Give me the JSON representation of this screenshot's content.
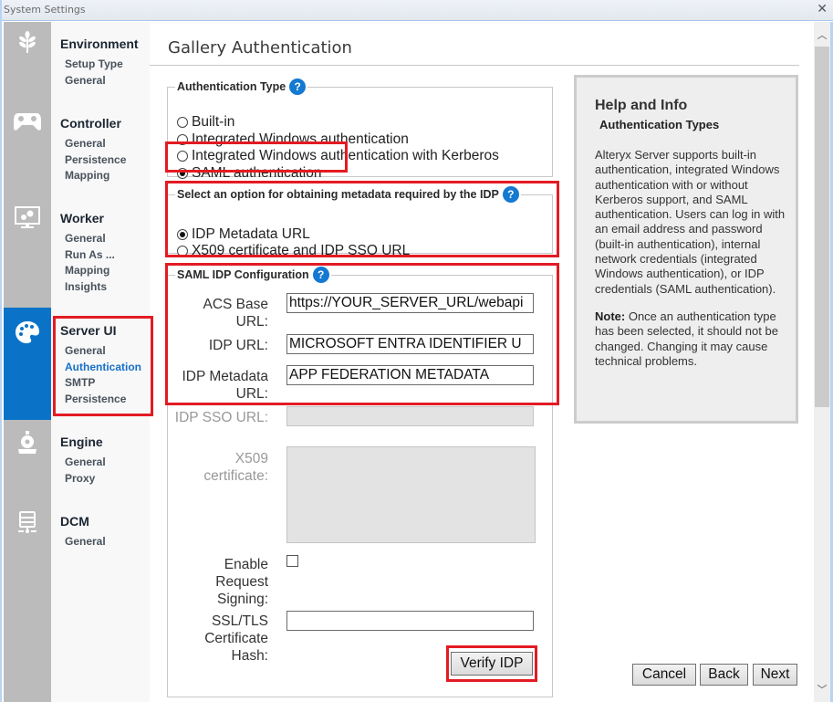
{
  "window": {
    "title": "System Settings",
    "close_icon": "close-x-icon"
  },
  "icon_rail": [
    {
      "icon": "wheat-icon",
      "section": "Environment"
    },
    {
      "icon": "gamepad-icon",
      "section": "Controller"
    },
    {
      "icon": "monitor-gears-icon",
      "section": "Worker"
    },
    {
      "icon": "palette-icon",
      "section": "Server UI",
      "active": true
    },
    {
      "icon": "train-icon",
      "section": "Engine"
    },
    {
      "icon": "database-icon",
      "section": "DCM"
    }
  ],
  "nav": {
    "groups": [
      {
        "title": "Environment",
        "items": [
          "Setup Type",
          "General"
        ]
      },
      {
        "title": "Controller",
        "items": [
          "General",
          "Persistence",
          "Mapping"
        ]
      },
      {
        "title": "Worker",
        "items": [
          "General",
          "Run As ...",
          "Mapping",
          "Insights"
        ]
      },
      {
        "title": "Server UI",
        "items": [
          "General",
          "Authentication",
          "SMTP",
          "Persistence"
        ],
        "active_item": "Authentication"
      },
      {
        "title": "Engine",
        "items": [
          "General",
          "Proxy"
        ]
      },
      {
        "title": "DCM",
        "items": [
          "General"
        ]
      }
    ]
  },
  "page": {
    "title": "Gallery Authentication",
    "auth_type": {
      "legend": "Authentication Type",
      "help_icon": "?",
      "options": [
        {
          "label": "Built-in",
          "selected": false
        },
        {
          "label": "Integrated Windows authentication",
          "selected": false
        },
        {
          "label": "Integrated Windows authentication with Kerberos",
          "selected": false
        },
        {
          "label": "SAML authentication",
          "selected": true
        }
      ]
    },
    "metadata_option": {
      "legend": "Select an option for obtaining metadata required by the IDP",
      "help_icon": "?",
      "options": [
        {
          "label": "IDP Metadata URL",
          "selected": true
        },
        {
          "label": "X509 certificate and IDP SSO URL",
          "selected": false
        }
      ]
    },
    "saml_config": {
      "legend": "SAML IDP Configuration",
      "help_icon": "?",
      "fields": {
        "acs_base_url": {
          "label": "ACS Base URL:",
          "value": "https://YOUR_SERVER_URL/webapi"
        },
        "idp_url": {
          "label": "IDP URL:",
          "value": "MICROSOFT ENTRA IDENTIFIER U"
        },
        "idp_metadata_url": {
          "label": "IDP Metadata URL:",
          "value": "APP FEDERATION METADATA"
        },
        "idp_sso_url": {
          "label": "IDP SSO URL:",
          "value": "",
          "disabled": true
        },
        "x509_certificate": {
          "label": "X509 certificate:",
          "value": "",
          "disabled": true
        },
        "enable_request_signing": {
          "label": "Enable Request Signing:",
          "checked": false
        },
        "ssl_tls_hash": {
          "label": "SSL/TLS Certificate Hash:",
          "value": ""
        }
      },
      "verify_button": "Verify IDP"
    }
  },
  "help": {
    "title": "Help and Info",
    "subtitle": "Authentication Types",
    "body": "Alteryx Server supports built-in authentication, integrated Windows authentication with or without Kerberos support, and SAML authentication. Users can log in with an email address and password (built-in authentication), internal network credentials (integrated Windows authentication), or IDP credentials (SAML authentication).",
    "note_label": "Note:",
    "note_text": " Once an authentication type has been selected, it should not be changed. Changing it may cause technical problems."
  },
  "footer": {
    "cancel": "Cancel",
    "back": "Back",
    "next": "Next"
  },
  "highlight_color": "#e31b23",
  "accent_color": "#0a73c8"
}
